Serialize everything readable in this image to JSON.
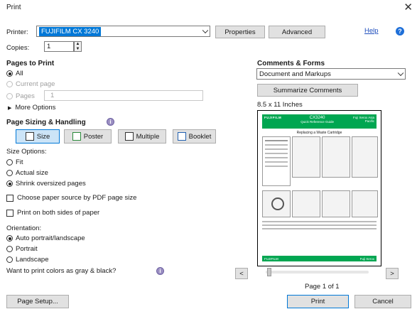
{
  "window": {
    "title": "Print"
  },
  "printer": {
    "label": "Printer:",
    "value": "FUJIFILM CX 3240",
    "properties": "Properties",
    "advanced": "Advanced",
    "help": "Help"
  },
  "copies": {
    "label": "Copies:",
    "value": "1"
  },
  "pages_to_print": {
    "heading": "Pages to Print",
    "all": "All",
    "current": "Current page",
    "pages": "Pages",
    "pages_value": "1",
    "more": "More Options"
  },
  "sizing": {
    "heading": "Page Sizing & Handling",
    "tabs": [
      "Size",
      "Poster",
      "Multiple",
      "Booklet"
    ],
    "size_options_label": "Size Options:",
    "fit": "Fit",
    "actual": "Actual size",
    "shrink": "Shrink oversized pages",
    "paper_source": "Choose paper source by PDF page size",
    "both_sides": "Print on both sides of paper",
    "orientation_label": "Orientation:",
    "auto": "Auto portrait/landscape",
    "portrait": "Portrait",
    "landscape": "Landscape",
    "gray": "Want to print colors as gray & black?"
  },
  "comments": {
    "heading": "Comments & Forms",
    "value": "Document and Markups",
    "summarize": "Summarize Comments",
    "paper_size": "8.5 x 11 Inches"
  },
  "preview_doc": {
    "brand": "FUJIFILM",
    "model": "CX3240",
    "guide": "Quick Reference Guide",
    "corner": "Fuji Xerox Asia Pacific",
    "heading": "Replacing a Waste Cartridge",
    "footer_brand": "FUJIFILM",
    "footer_right": "Fuji Xerox"
  },
  "nav": {
    "prev": "<",
    "next": ">",
    "page": "Page 1 of 1"
  },
  "footer": {
    "page_setup": "Page Setup...",
    "print": "Print",
    "cancel": "Cancel"
  },
  "colors": {
    "accent": "#0078d7",
    "brand_green": "#00a651"
  }
}
